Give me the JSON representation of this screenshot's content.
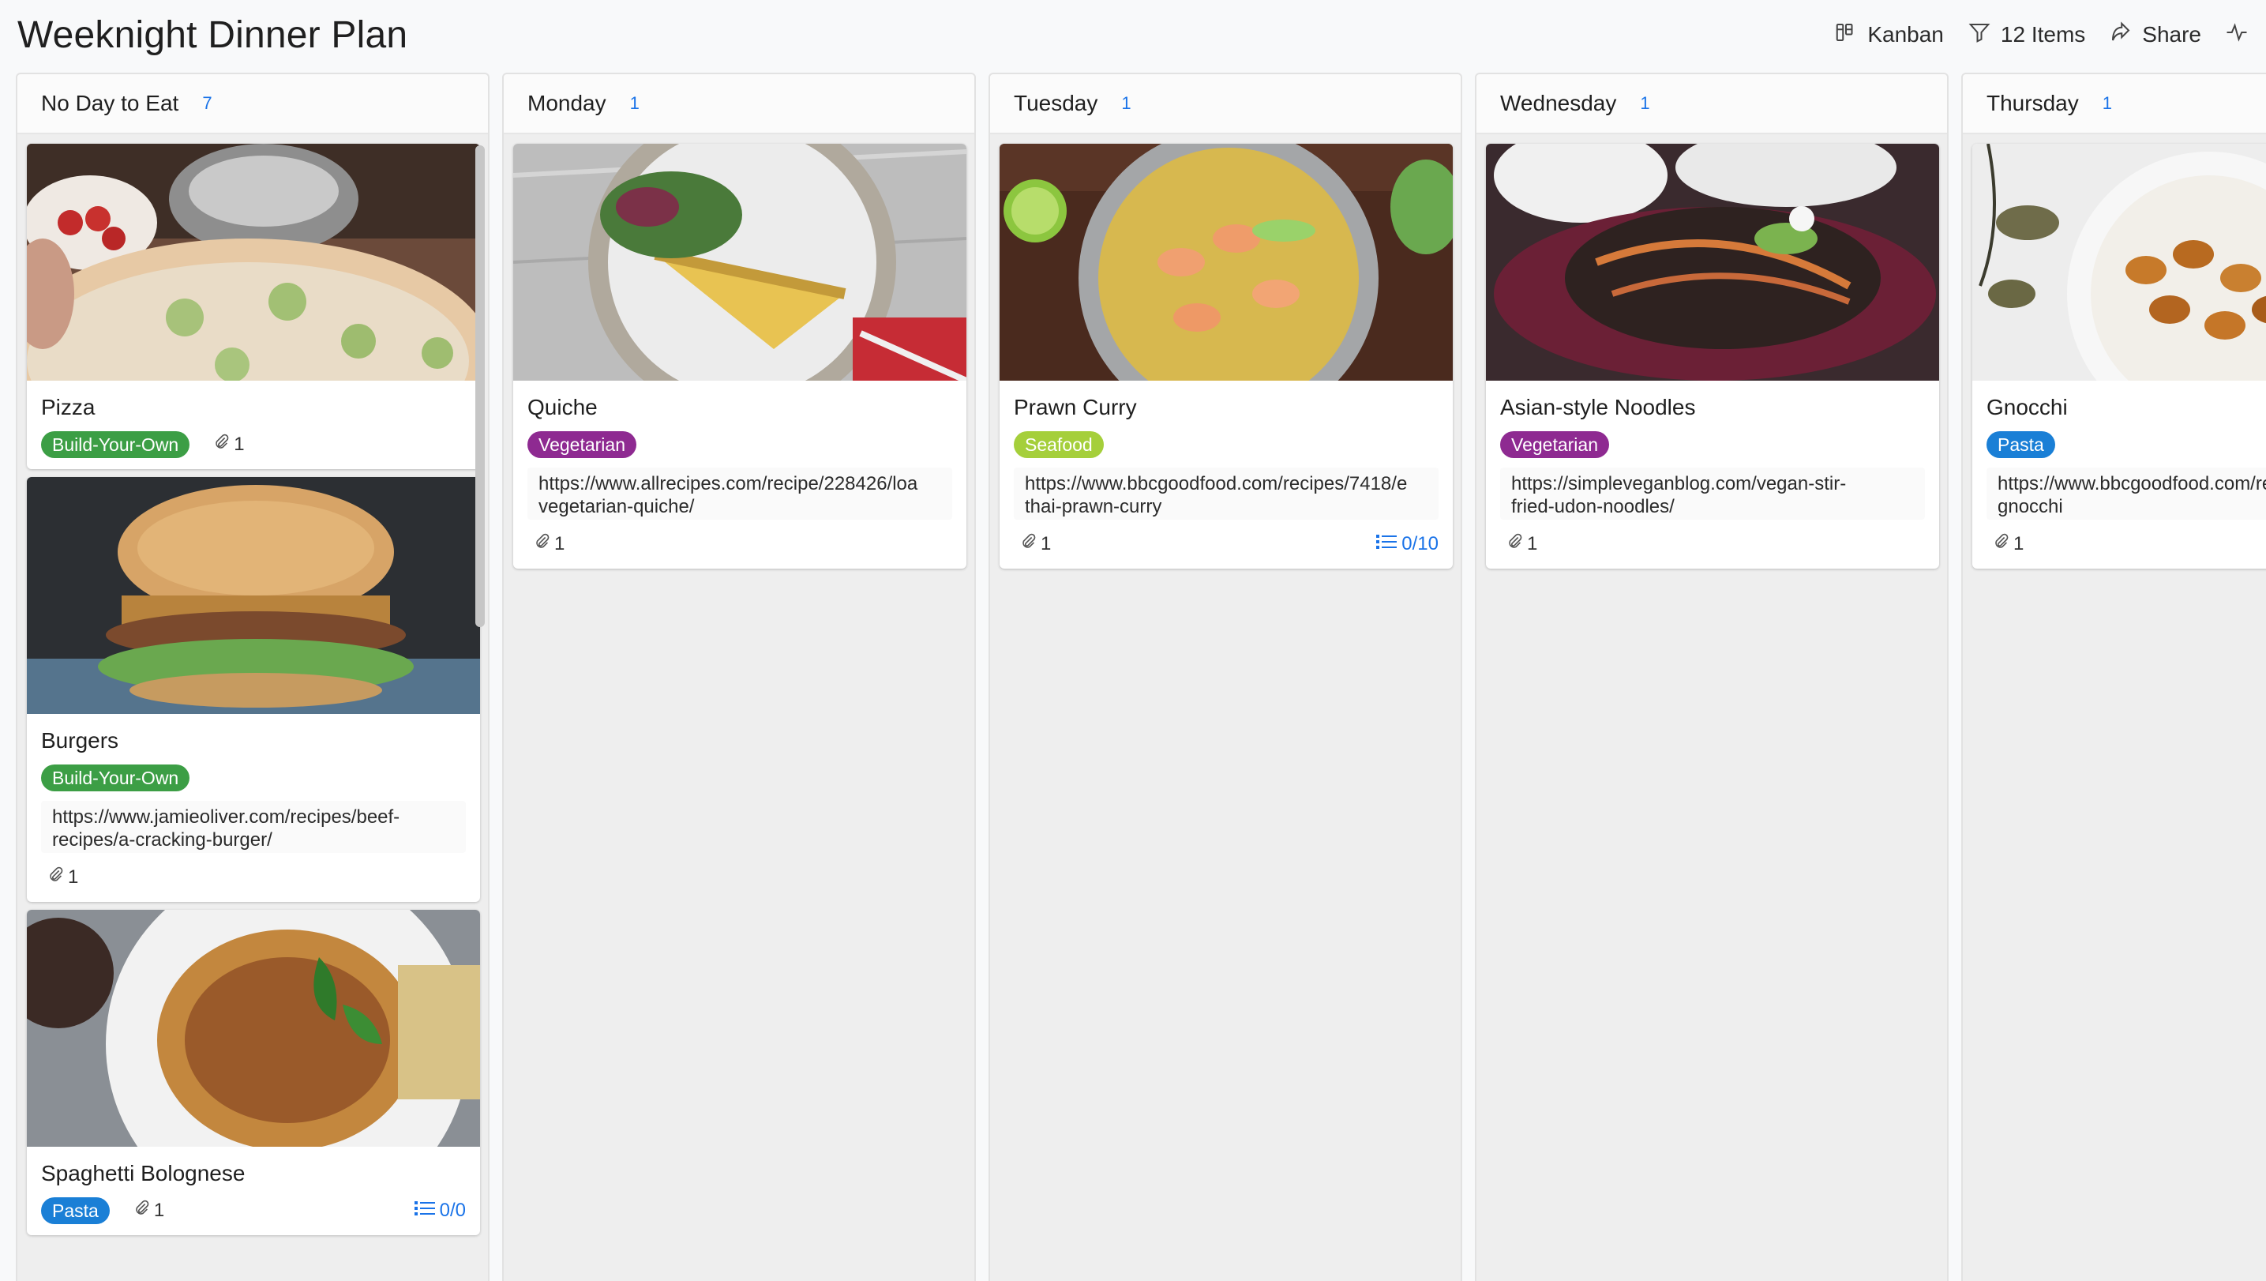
{
  "header": {
    "title": "Weeknight Dinner Plan",
    "view_label": "Kanban",
    "filter_label": "12 Items",
    "share_label": "Share"
  },
  "colors": {
    "build_your_own": "#3c9e45",
    "vegetarian": "#8e2a91",
    "seafood": "#a5cf3b",
    "pasta": "#1a7fd6",
    "count": "#1a73e8"
  },
  "columns": [
    {
      "name": "No Day to Eat",
      "count": "7",
      "cards": [
        {
          "title": "Pizza",
          "tag": "Build-Your-Own",
          "attachments": "1"
        },
        {
          "title": "Burgers",
          "tag": "Build-Your-Own",
          "link": "https://www.jamieoliver.com/recipes/beef-\nrecipes/a-cracking-burger/",
          "attachments": "1"
        },
        {
          "title": "Spaghetti Bolognese",
          "tag": "Pasta",
          "attachments": "1",
          "checklist": "0/0"
        }
      ]
    },
    {
      "name": "Monday",
      "count": "1",
      "cards": [
        {
          "title": "Quiche",
          "tag": "Vegetarian",
          "link": "https://www.allrecipes.com/recipe/228426/loa\nvegetarian-quiche/",
          "attachments": "1"
        }
      ]
    },
    {
      "name": "Tuesday",
      "count": "1",
      "cards": [
        {
          "title": "Prawn Curry",
          "tag": "Seafood",
          "link": "https://www.bbcgoodfood.com/recipes/7418/e\nthai-prawn-curry",
          "attachments": "1",
          "checklist": "0/10"
        }
      ]
    },
    {
      "name": "Wednesday",
      "count": "1",
      "cards": [
        {
          "title": "Asian-style Noodles",
          "tag": "Vegetarian",
          "link": "https://simpleveganblog.com/vegan-stir-\nfried-udon-noodles/",
          "attachments": "1"
        }
      ]
    },
    {
      "name": "Thursday",
      "count": "1",
      "cards": [
        {
          "title": "Gnocchi",
          "tag": "Pasta",
          "link": "https://www.bbcgoodfood.com/recipes/\ngnocchi",
          "attachments": "1"
        }
      ]
    }
  ]
}
